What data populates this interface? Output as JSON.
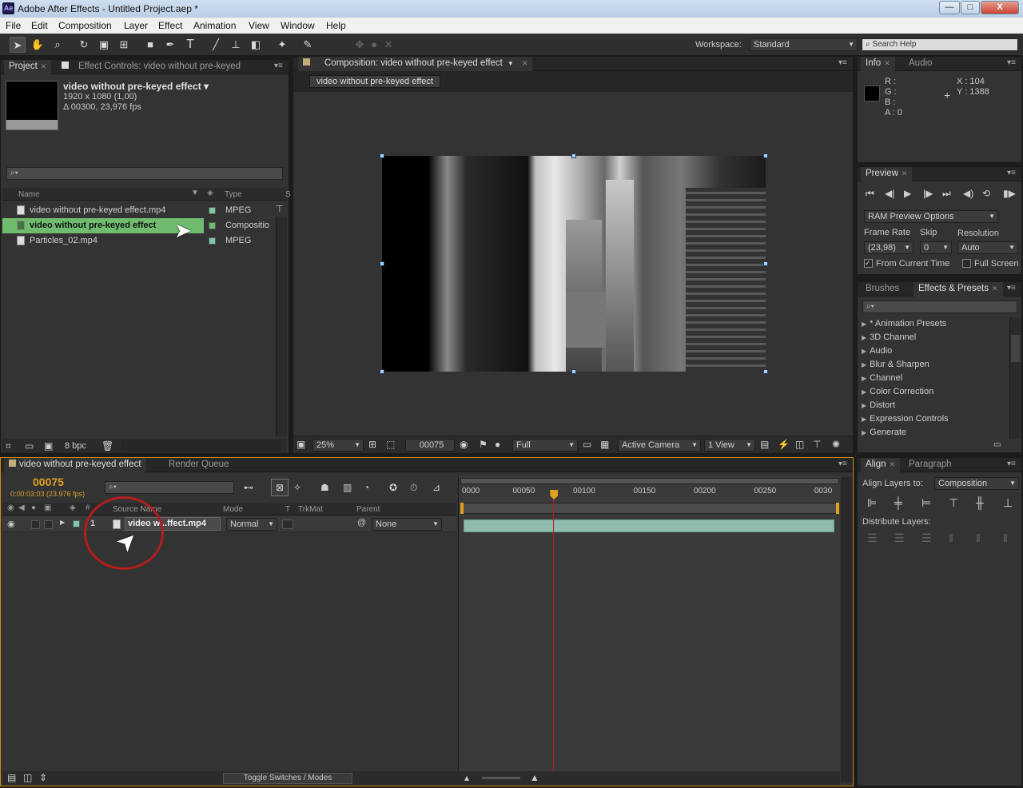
{
  "window": {
    "app_logo": "Ae",
    "title": "Adobe After Effects - Untitled Project.aep *",
    "minimize": "—",
    "maximize": "□",
    "close": "X"
  },
  "menu": [
    "File",
    "Edit",
    "Composition",
    "Layer",
    "Effect",
    "Animation",
    "View",
    "Window",
    "Help"
  ],
  "toolbar": {
    "workspace_label": "Workspace:",
    "workspace_value": "Standard",
    "search_placeholder": "Search Help",
    "search_icon": "search-icon"
  },
  "project": {
    "tab_project": "Project",
    "tab_effect_controls": "Effect Controls: video without pre-keyed",
    "item_name": "video without pre-keyed effect ▾",
    "item_res": "1920 x 1080 (1,00)",
    "item_dur": "Δ 00300, 23,976 fps",
    "col_name": "Name",
    "col_type": "Type",
    "col_s": "S",
    "items": [
      {
        "name": "video without pre-keyed effect.mp4",
        "type": "MPEG"
      },
      {
        "name": "video without pre-keyed effect",
        "type": "Compositio"
      },
      {
        "name": "Particles_02.mp4",
        "type": "MPEG"
      }
    ],
    "bpc": "8 bpc"
  },
  "composition": {
    "tab": "Composition: video without pre-keyed effect",
    "subtab": "video without pre-keyed effect",
    "zoom": "25%",
    "timecode": "00075",
    "resolution": "Full",
    "camera": "Active Camera",
    "views": "1 View"
  },
  "info": {
    "tab_info": "Info",
    "tab_audio": "Audio",
    "r": "R :",
    "g": "G :",
    "b": "B :",
    "a": "A : 0",
    "x": "X : 104",
    "y": "Y : 1388",
    "cursor_glyph": "+"
  },
  "preview": {
    "tab": "Preview",
    "ram_options": "RAM Preview Options",
    "frame_rate_label": "Frame Rate",
    "skip_label": "Skip",
    "resolution_label": "Resolution",
    "frame_rate": "(23,98)",
    "skip": "0",
    "resolution": "Auto",
    "from_current": "From Current Time",
    "full_screen": "Full Screen"
  },
  "effects": {
    "tab_brushes": "Brushes",
    "tab_fx": "Effects & Presets",
    "items": [
      "* Animation Presets",
      "3D Channel",
      "Audio",
      "Blur & Sharpen",
      "Channel",
      "Color Correction",
      "Distort",
      "Expression Controls",
      "Generate"
    ]
  },
  "align": {
    "tab_align": "Align",
    "tab_paragraph": "Paragraph",
    "align_to_label": "Align Layers to:",
    "align_to": "Composition",
    "distribute_label": "Distribute Layers:"
  },
  "timeline": {
    "tab_comp": "video without pre-keyed effect",
    "tab_render": "Render Queue",
    "timecode": "00075",
    "timecode_sub": "0:00:03:03 (23.976 fps)",
    "col_source": "Source Name",
    "col_mode": "Mode",
    "col_t": "T",
    "col_trkmat": "TrkMat",
    "col_parent": "Parent",
    "layer": {
      "num": "1",
      "name": "video w...ffect.mp4",
      "mode": "Normal",
      "parent": "None"
    },
    "ruler": [
      "0000",
      "00050",
      "00100",
      "00150",
      "00200",
      "00250",
      "0030"
    ],
    "toggle": "Toggle Switches / Modes",
    "current_frame": 75,
    "duration_frames": 300
  }
}
